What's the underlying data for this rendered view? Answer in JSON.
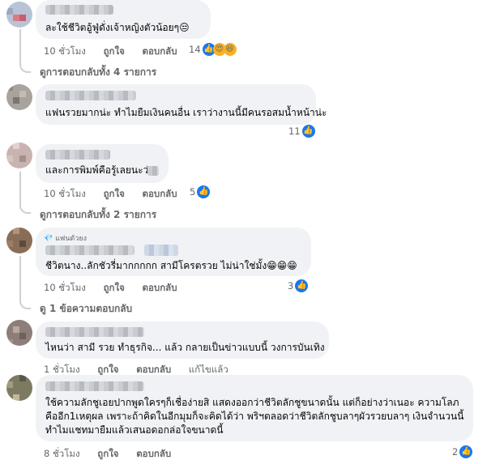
{
  "comments": [
    {
      "text_lines": [
        "ละใช้ชีวิตอู้ฟู่ดั่งเจ้าหญิงตัวน้อยๆ😒"
      ],
      "time": "10 ชั่วโมง",
      "like": "ถูกใจ",
      "reply": "ตอบกลับ",
      "reaction_count": "14",
      "view_replies": "ดูการตอบกลับทั้ง 4 รายการ"
    },
    {
      "text_lines": [
        "แฟนรวยมากน่ะ ทำไมยืมเงินคนอื่น เราว่างานนี้มีคนรอสมน้ำหน้าน่ะ"
      ],
      "reaction_count": "11"
    },
    {
      "text_lines": [
        "และการพิมพ์คือรู้เลยนะว่า"
      ],
      "time": "10 ชั่วโมง",
      "like": "ถูกใจ",
      "reply": "ตอบกลับ",
      "reaction_count": "5",
      "view_replies": "ดูการตอบกลับทั้ง 2 รายการ"
    },
    {
      "badge": "แฟนตัวยง",
      "text_lines": [
        "ชีวิตนาง..ลักชัวรี่มากกกกก สามีโครตรวย ไม่น่าใช่มั้ง😁😁😁"
      ],
      "time": "10 ชั่วโมง",
      "like": "ถูกใจ",
      "reply": "ตอบกลับ",
      "reaction_count": "3",
      "view_replies": "ดู 1 ข้อความตอบกลับ"
    },
    {
      "text_lines": [
        "ไหนว่า สามี รวย ทำธุรกิจ... แล้ว กลายเป็นข่าวแบบนี้ วงการบันเทิง"
      ],
      "time": "1 ชั่วโมง",
      "like": "ถูกใจ",
      "reply": "ตอบกลับ",
      "edited": "แก้ไขแล้ว"
    },
    {
      "text_lines": [
        "ใช้ความลักชูเอยปากพูดใครๆก็เชื่อง่ายสิ แสดงออกว่าชีวิตลักชูขนาดนั้น แต่ก็อย่างว่าเนอะ ความโลภ",
        "คืออีก1เหตุผล เพราะถ้าคิดในอีกมุมก็จะคิดได้ว่า พริฯตลอดว่าชีวิตลักชูบลาๆผัวรวยบลาๆ เงินจำนวนนี้",
        "ทำไมแชทมายืมแล้วเสนอดอกล่อใจขนาดนี้"
      ],
      "time": "8 ชั่วโมง",
      "like": "ถูกใจ",
      "reply": "ตอบกลับ",
      "reaction_count": "2"
    }
  ],
  "colors": {
    "bubble": "#f0f2f5",
    "meta": "#65676b",
    "like_blue": "#1877f2"
  }
}
